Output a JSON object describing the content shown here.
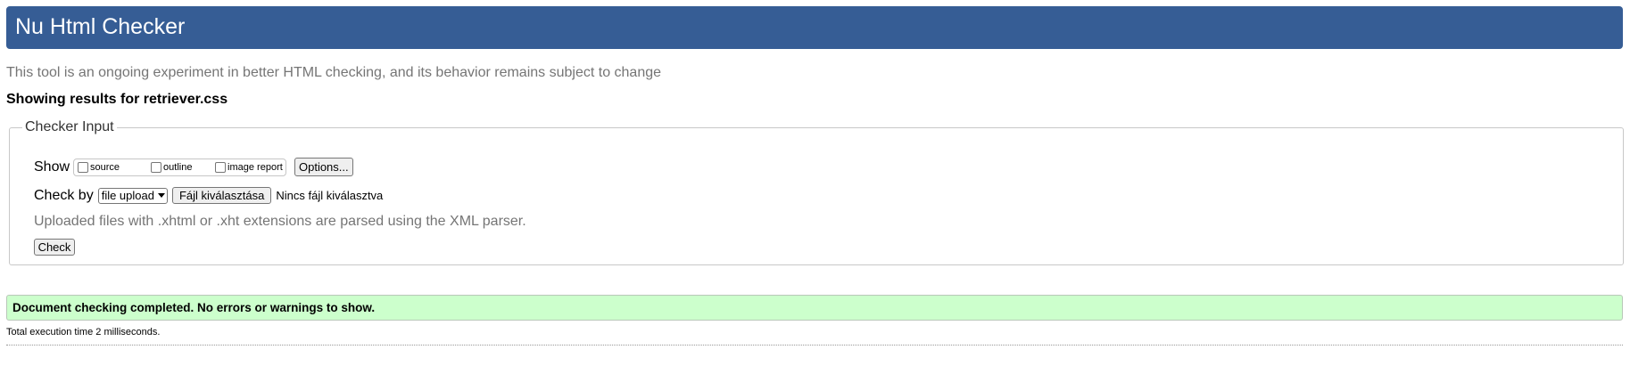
{
  "header": {
    "title": "Nu Html Checker"
  },
  "subtitle": "This tool is an ongoing experiment in better HTML checking, and its behavior remains subject to change",
  "showing_results": "Showing results for retriever.css",
  "checker_input": {
    "legend": "Checker Input",
    "show_label": "Show",
    "show_options": [
      {
        "label": "source",
        "checked": false
      },
      {
        "label": "outline",
        "checked": false
      },
      {
        "label": "image report",
        "checked": false
      }
    ],
    "options_button": "Options...",
    "check_by_label": "Check by",
    "check_by_selected": "file upload",
    "file_button": "Fájl kiválasztása",
    "no_file_text": "Nincs fájl kiválasztva",
    "note": "Uploaded files with .xhtml or .xht extensions are parsed using the XML parser.",
    "check_button": "Check"
  },
  "result": {
    "message": "Document checking completed. No errors or warnings to show.",
    "execution_time": "Total execution time 2 milliseconds."
  },
  "colors": {
    "header_bg": "#365d95",
    "success_bg": "#ccffcc",
    "muted_text": "#757575"
  }
}
